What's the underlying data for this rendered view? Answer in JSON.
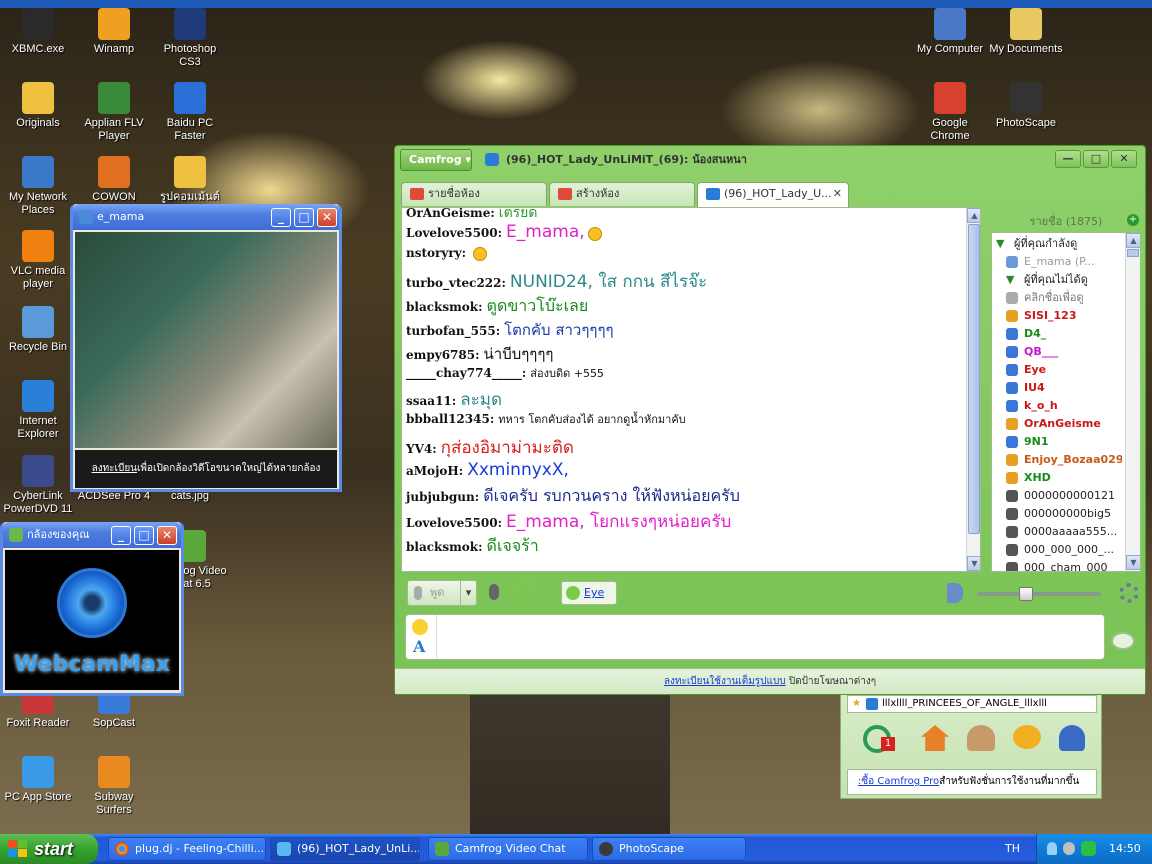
{
  "desktop_icons": [
    {
      "label": "XBMC.exe",
      "color": "#2a2a2a"
    },
    {
      "label": "Winamp",
      "color": "#f0a020"
    },
    {
      "label": "Photoshop CS3",
      "color": "#1e3a7a"
    },
    {
      "label": "My Computer",
      "color": "#4a78c8"
    },
    {
      "label": "My Documents",
      "color": "#e8c860"
    },
    {
      "label": "Originals",
      "color": "#f0c040"
    },
    {
      "label": "Applian FLV Player",
      "color": "#3a8a3a"
    },
    {
      "label": "Baidu PC Faster",
      "color": "#2a70d8"
    },
    {
      "label": "Google Chrome",
      "color": "#d84030"
    },
    {
      "label": "PhotoScape",
      "color": "#333333"
    },
    {
      "label": "My Network Places",
      "color": "#3a78c8"
    },
    {
      "label": "COWON Media",
      "color": "#e07020"
    },
    {
      "label": "รูปคอมเม้นต์",
      "color": "#f0c040"
    },
    {
      "label": "VLC media player",
      "color": "#f08010"
    },
    {
      "label": "Recycle Bin",
      "color": "#5a9ad8"
    },
    {
      "label": "Internet Explorer",
      "color": "#2a80d8"
    },
    {
      "label": "CyberLink PowerDVD 11",
      "color": "#3a4a8a"
    },
    {
      "label": "ACDSee Pro 4",
      "color": "#c83030"
    },
    {
      "label": "cats.jpg",
      "color": "#9a8a6a"
    },
    {
      "label": "Camfrog Video Chat 6.5",
      "color": "#5aa83a"
    },
    {
      "label": "Foxit Reader",
      "color": "#c83838"
    },
    {
      "label": "SopCast",
      "color": "#3a7ad8"
    },
    {
      "label": "PC App Store",
      "color": "#3a9ae8"
    },
    {
      "label": "Subway Surfers",
      "color": "#e88a20"
    }
  ],
  "webcam_window": {
    "title": "e_mama",
    "link_text": "ลงทะเบียน",
    "caption_rest": "เพื่อเปิดกล้องวิดีโอขนาดใหญ่ได้หลายกล้อง"
  },
  "mycam_window": {
    "title": "กล้องของคุณ",
    "brand": "WebcamMax"
  },
  "camfrog": {
    "menu_label": "Camfrog",
    "window_title": "(96)_HOT_Lady_UnLiMiT_(69): น้องสนหนา",
    "tabs": [
      {
        "label": "รายชื่อห้อง"
      },
      {
        "label": "สร้างห้อง"
      },
      {
        "label": "(96)_HOT_Lady_U..."
      }
    ],
    "messages": [
      {
        "nick": "OrAnGeisme:",
        "text": "เตรียด",
        "color": "#2a9a2a",
        "size": 14
      },
      {
        "nick": "Lovelove5500:",
        "text": "E_mama,",
        "color": "#e020c8",
        "size": 17,
        "emoji": true
      },
      {
        "nick": "nstoryry:",
        "text": "",
        "color": "#000",
        "size": 12,
        "emoji": true
      },
      {
        "nick": "turbo_vtec222:",
        "text": "NUNID24, ใส กกน สีไรจ๊ะ",
        "color": "#2a8a8a",
        "size": 17
      },
      {
        "nick": "blacksmok:",
        "text": "ตูดขาวโบ๊ะเลย",
        "color": "#1a8a1a",
        "size": 16
      },
      {
        "nick": "turbofan_555:",
        "text": "โตกคับ สาวๆๆๆๆ",
        "color": "#1a3aa8",
        "size": 15
      },
      {
        "nick": "empy6785:",
        "text": "น่าบีบๆๆๆๆ",
        "color": "#111",
        "size": 15
      },
      {
        "nick": "_____chay774_____:",
        "text": "ส่องบดิด +555",
        "color": "#111",
        "size": 11
      },
      {
        "nick": "ssaa11:",
        "text": "ละมุด",
        "color": "#2a8a8a",
        "size": 17
      },
      {
        "nick": "bbball12345:",
        "text": "ทหาร โตกคับส่องได้ อยากดูน้ำหักมาคับ",
        "color": "#111",
        "size": 11
      },
      {
        "nick": "YV4:",
        "text": "กุส่องอิมาม่ามะติด",
        "color": "#d82020",
        "size": 17
      },
      {
        "nick": "aMojoH:",
        "text": "XxminnyxX,",
        "color": "#1a3ad8",
        "size": 17
      },
      {
        "nick": "jubjubgun:",
        "text": "ดีเจครับ รบกวนคราง ให้ฟังหน่อยครับ",
        "color": "#1a2a8a",
        "size": 16
      },
      {
        "nick": "Lovelove5500:",
        "text": "E_mama, โยกแรงๆหน่อยครับ",
        "color": "#e020c8",
        "size": 17
      },
      {
        "nick": "blacksmok:",
        "text": "ดีเจจร้า",
        "color": "#1a8a1a",
        "size": 16
      }
    ],
    "user_list": {
      "header": "รายชื่อ (1875)",
      "group1": "ผู้ที่คุณกำลังดู",
      "group2": "ผู้ที่คุณไม่ได้ดู",
      "rows": [
        {
          "name": "E_mama (P...",
          "color": "#9a9a9a"
        },
        {
          "name": "คลิกชื่อเพื่อดู",
          "color": "#777777"
        },
        {
          "name": "SISI_123",
          "color": "#c81818"
        },
        {
          "name": "D4_",
          "color": "#1a8a1a"
        },
        {
          "name": "QB___",
          "color": "#c818c8"
        },
        {
          "name": "Eye",
          "color": "#c81818"
        },
        {
          "name": "IU4",
          "color": "#c81818"
        },
        {
          "name": "k_o_h",
          "color": "#c81818"
        },
        {
          "name": "OrAnGeisme",
          "color": "#c81818"
        },
        {
          "name": "9N1",
          "color": "#1a8a1a"
        },
        {
          "name": "Enjoy_Bozaa029",
          "color": "#c85a18"
        },
        {
          "name": "XHD",
          "color": "#1a8a1a"
        },
        {
          "name": "0000000000121",
          "color": "#222222"
        },
        {
          "name": "000000000big5",
          "color": "#222222"
        },
        {
          "name": "0000aaaaa555...",
          "color": "#222222"
        },
        {
          "name": "000_000_000_...",
          "color": "#222222"
        },
        {
          "name": "000_cham_000",
          "color": "#222222"
        }
      ]
    },
    "toolbar": {
      "talk_label": "พูด",
      "eye_label": "Eye"
    },
    "ad": {
      "link": "ลงทะเบียนใช้งานเต็มรูปแบบ",
      "rest": "ปิดป้ายโฆษณาต่างๆ"
    }
  },
  "camfrog_panel": {
    "room_name": "lllxllll_PRINCEES_OF_ANGLE_lllxlll",
    "badge": "1",
    "promo_link": ":ซื้อ Camfrog Pro",
    "promo_rest": "สำหรับฟังชั่นการใช้งานที่มากขึ้น"
  },
  "taskbar": {
    "start_label": "start",
    "tasks": [
      {
        "label": "plug.dj - Feeling-Chilli..."
      },
      {
        "label": "(96)_HOT_Lady_UnLi..."
      },
      {
        "label": "Camfrog Video Chat"
      },
      {
        "label": "PhotoScape"
      }
    ],
    "lang": "TH",
    "clock": "14:50"
  }
}
